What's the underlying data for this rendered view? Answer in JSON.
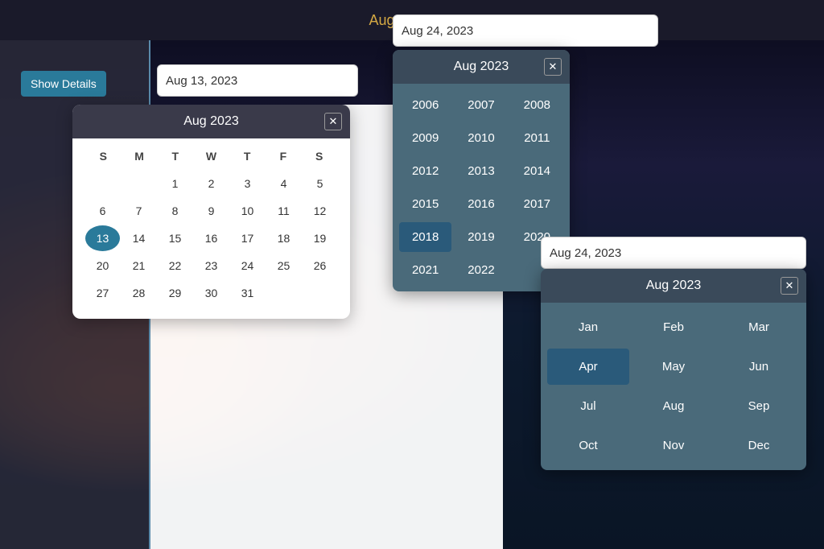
{
  "header": {
    "date_label": "Aug 13, 2023"
  },
  "show_details": {
    "label": "Show Details"
  },
  "date_input_left": {
    "value": "Aug 13, 2023"
  },
  "date_input_right": {
    "value": "Aug 24, 2023"
  },
  "date_input_month": {
    "value": "Aug 24, 2023"
  },
  "calendar_left": {
    "header": "Aug  2023",
    "close_label": "✕",
    "weekdays": [
      "S",
      "M",
      "T",
      "W",
      "T",
      "F",
      "S"
    ],
    "days": [
      {
        "day": "",
        "empty": true
      },
      {
        "day": "",
        "empty": true
      },
      {
        "day": "1"
      },
      {
        "day": "2"
      },
      {
        "day": "3"
      },
      {
        "day": "4"
      },
      {
        "day": "5"
      },
      {
        "day": "6"
      },
      {
        "day": "7"
      },
      {
        "day": "8"
      },
      {
        "day": "9"
      },
      {
        "day": "10"
      },
      {
        "day": "11"
      },
      {
        "day": "12"
      },
      {
        "day": "13",
        "selected": true
      },
      {
        "day": "14"
      },
      {
        "day": "15"
      },
      {
        "day": "16"
      },
      {
        "day": "17"
      },
      {
        "day": "18"
      },
      {
        "day": "19"
      },
      {
        "day": "20"
      },
      {
        "day": "21"
      },
      {
        "day": "22"
      },
      {
        "day": "23"
      },
      {
        "day": "24"
      },
      {
        "day": "25"
      },
      {
        "day": "26"
      },
      {
        "day": "27"
      },
      {
        "day": "28"
      },
      {
        "day": "29"
      },
      {
        "day": "30"
      },
      {
        "day": "31"
      },
      {
        "day": "",
        "empty": true
      },
      {
        "day": "",
        "empty": true
      }
    ]
  },
  "year_picker": {
    "header": "Aug  2023",
    "close_label": "✕",
    "years": [
      {
        "year": "2006"
      },
      {
        "year": "2007"
      },
      {
        "year": "2008"
      },
      {
        "year": "2009"
      },
      {
        "year": "2010"
      },
      {
        "year": "2011"
      },
      {
        "year": "2012"
      },
      {
        "year": "2013"
      },
      {
        "year": "2014"
      },
      {
        "year": "2015"
      },
      {
        "year": "2016"
      },
      {
        "year": "2017"
      },
      {
        "year": "2018",
        "selected": true
      },
      {
        "year": "2019"
      },
      {
        "year": "2020",
        "empty": true
      },
      {
        "year": "2021"
      },
      {
        "year": "2022"
      }
    ]
  },
  "month_picker": {
    "header": "Aug  2023",
    "close_label": "✕",
    "months": [
      {
        "month": "Jan"
      },
      {
        "month": "Feb"
      },
      {
        "month": "Mar"
      },
      {
        "month": "Apr",
        "selected": true
      },
      {
        "month": "May"
      },
      {
        "month": "Jun"
      },
      {
        "month": "Jul"
      },
      {
        "month": "Aug"
      },
      {
        "month": "Sep"
      },
      {
        "month": "Oct"
      },
      {
        "month": "Nov"
      },
      {
        "month": "Dec"
      }
    ]
  }
}
